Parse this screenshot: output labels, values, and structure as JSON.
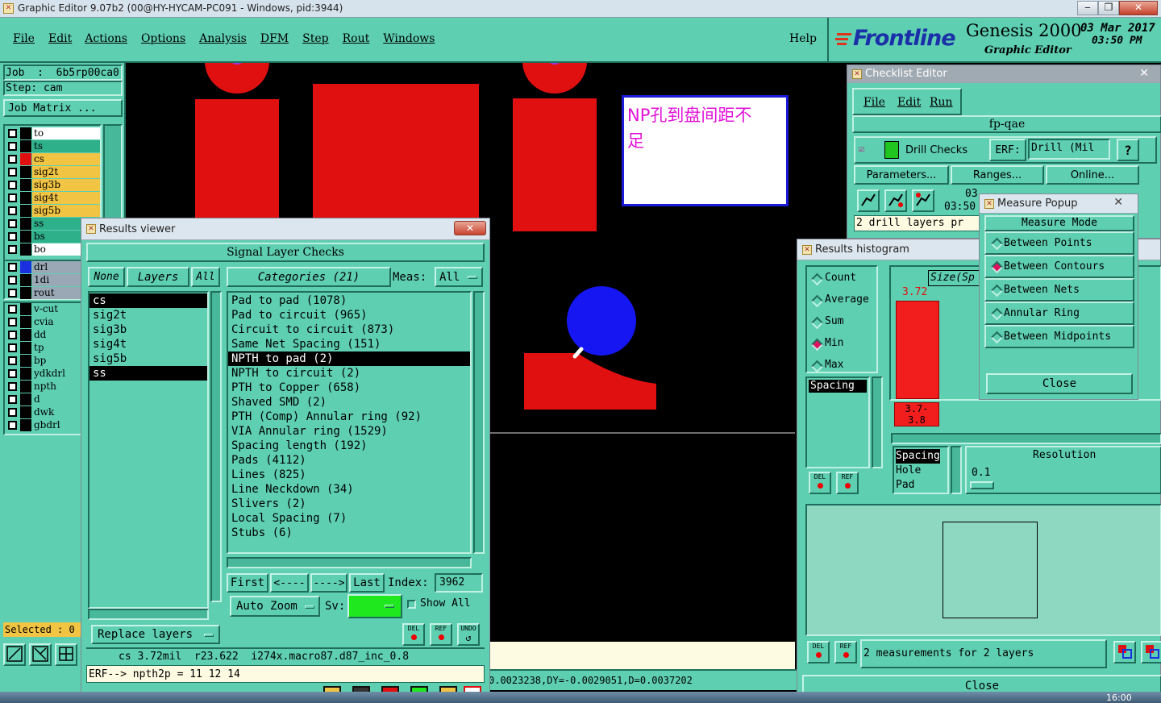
{
  "window": {
    "title": "Graphic Editor 9.07b2 (00@HY-HYCAM-PC091 - Windows, pid:3944)"
  },
  "menu": {
    "items": [
      "File",
      "Edit",
      "Actions",
      "Options",
      "Analysis",
      "DFM",
      "Step",
      "Rout",
      "Windows"
    ],
    "help": "Help"
  },
  "brand": {
    "logo": "Frontline",
    "product": "Genesis 2000",
    "subtitle": "Graphic Editor",
    "date": "03 Mar 2017",
    "time": "03:50 PM"
  },
  "job": {
    "job_label": "Job  :  6b5rp00ca0",
    "step_label": "Step: cam",
    "matrix_button": "Job Matrix ..."
  },
  "layers": [
    {
      "name": "to",
      "color": "#000000",
      "bg": "#ffffff"
    },
    {
      "name": "ts",
      "color": "#000000",
      "bg": "#2eb08a"
    },
    {
      "name": "cs",
      "color": "#e01010",
      "bg": "#f2c443"
    },
    {
      "name": "sig2t",
      "color": "#000000",
      "bg": "#f2c443"
    },
    {
      "name": "sig3b",
      "color": "#000000",
      "bg": "#f2c443"
    },
    {
      "name": "sig4t",
      "color": "#000000",
      "bg": "#f2c443"
    },
    {
      "name": "sig5b",
      "color": "#000000",
      "bg": "#f2c443"
    },
    {
      "name": "ss",
      "color": "#000000",
      "bg": "#2eb08a"
    },
    {
      "name": "bs",
      "color": "#000000",
      "bg": "#2eb08a"
    },
    {
      "name": "bo",
      "color": "#000000",
      "bg": "#ffffff"
    }
  ],
  "drill_layers": [
    {
      "name": "drl",
      "color": "#1a30e0",
      "bg": "#9aa8b6"
    },
    {
      "name": "1di",
      "color": "#000000",
      "bg": "#9aa8b6"
    },
    {
      "name": "rout",
      "color": "#000000",
      "bg": "#9aa8b6"
    }
  ],
  "doc_layers": [
    "v-cut",
    "cvia",
    "dd",
    "tp",
    "bp",
    "ydkdrl",
    "npth",
    "d",
    "dwk",
    "gbdrl"
  ],
  "selected_label": "Selected : 0",
  "annotation": {
    "line1": "NP孔到盘间距不",
    "line2": "足"
  },
  "results_viewer": {
    "title": "Results viewer",
    "header": "Signal Layer Checks",
    "none_btn": "None",
    "layers_btn": "Layers",
    "all_btn": "All",
    "categories_btn": "Categories (21)",
    "meas_label": "Meas:",
    "meas_value": "All",
    "layer_list": [
      "cs",
      "sig2t",
      "sig3b",
      "sig4t",
      "sig5b",
      "ss"
    ],
    "categories": [
      "Pad to pad (1078)",
      "Pad to circuit (965)",
      "Circuit to circuit (873)",
      "Same Net Spacing (151)",
      "NPTH to pad (2)",
      "NPTH to circuit (2)",
      "PTH to Copper (658)",
      "Shaved SMD (2)",
      "PTH (Comp) Annular ring (92)",
      "VIA Annular ring (1529)",
      "Spacing length (192)",
      "Pads (4112)",
      "Lines (825)",
      "Line Neckdown (34)",
      "Slivers (2)",
      "Local Spacing (7)",
      "Stubs (6)"
    ],
    "first_btn": "First",
    "prev_btn": "<----",
    "next_btn": "---->",
    "last_btn": "Last",
    "index_label": "Index:",
    "index_value": "3962",
    "auto_zoom": "Auto Zoom",
    "sv_label": "Sv:",
    "show_all": "Show All",
    "replace_layers": "Replace layers",
    "del": "DEL",
    "ref": "REF",
    "undo": "UNDO",
    "info_line": "cs 3.72mil  r23.622  i274x.macro87.d87_inc_0.8",
    "erf_line": "ERF--> npth2p = 11 12 14"
  },
  "coords": "0.0023238,DY=-0.0029051,D=0.0037202",
  "checklist": {
    "title": "Checklist Editor",
    "menu": [
      "File",
      "Edit",
      "Run"
    ],
    "name": "fp-qae",
    "check_name": "Drill Checks",
    "erf_label": "ERF:",
    "erf_value": "Drill (Mil",
    "help": "?",
    "parameters": "Parameters...",
    "ranges": "Ranges...",
    "online": "Online...",
    "date_fragment": "03",
    "time_fragment": "03:50",
    "status": "2 drill layers pr"
  },
  "measure": {
    "title": "Measure Popup",
    "header": "Measure Mode",
    "modes": [
      {
        "label": "Between Points",
        "selected": false
      },
      {
        "label": "Between Contours",
        "selected": true
      },
      {
        "label": "Between Nets",
        "selected": false
      },
      {
        "label": "Annular Ring",
        "selected": false
      },
      {
        "label": "Between Midpoints",
        "selected": false
      }
    ],
    "close": "Close"
  },
  "histogram": {
    "title": "Results histogram",
    "stats": [
      {
        "label": "Count",
        "selected": false
      },
      {
        "label": "Average",
        "selected": false
      },
      {
        "label": "Sum",
        "selected": false
      },
      {
        "label": "Min",
        "selected": true
      },
      {
        "label": "Max",
        "selected": false
      }
    ],
    "metric_selected": "Spacing",
    "size_label": "Size(Sp",
    "bar_value": "3.72",
    "bar_range_1": "3.7-",
    "bar_range_2": "3.8",
    "types": [
      "Spacing",
      "Hole",
      "Pad"
    ],
    "resolution_label": "Resolution",
    "resolution_value": "0.1",
    "del": "DEL",
    "ref": "REF",
    "measurements": "2 measurements for 2 layers",
    "close": "Close"
  },
  "taskbar": {
    "time": "16:00"
  }
}
